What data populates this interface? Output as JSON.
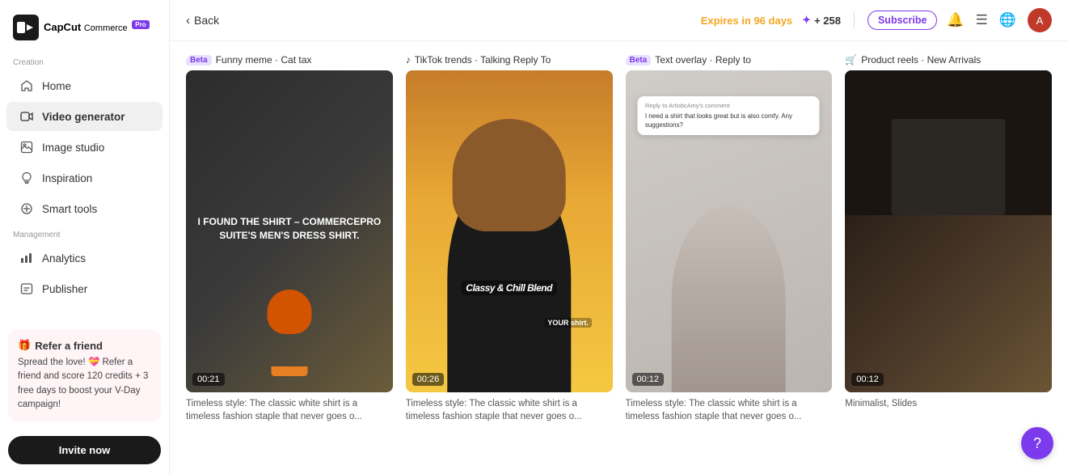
{
  "app": {
    "logo_text": "CapCut",
    "logo_sub": "Commerce",
    "logo_badge": "Pro"
  },
  "sidebar": {
    "section_creation": "Creation",
    "section_management": "Management",
    "items": [
      {
        "id": "home",
        "label": "Home",
        "icon": "home"
      },
      {
        "id": "video-generator",
        "label": "Video generator",
        "icon": "video",
        "active": true
      },
      {
        "id": "image-studio",
        "label": "Image studio",
        "icon": "image"
      },
      {
        "id": "inspiration",
        "label": "Inspiration",
        "icon": "inspiration"
      },
      {
        "id": "smart-tools",
        "label": "Smart tools",
        "icon": "smart"
      },
      {
        "id": "analytics",
        "label": "Analytics",
        "icon": "analytics"
      },
      {
        "id": "publisher",
        "label": "Publisher",
        "icon": "publisher"
      }
    ],
    "refer": {
      "title": "Refer a friend",
      "gift_icon": "🎁",
      "heart_icon": "💝",
      "description": "Spread the love! 💝 Refer a friend and score 120 credits + 3 free days to boost your V-Day campaign!"
    },
    "invite_label": "Invite now"
  },
  "header": {
    "back_label": "Back",
    "expires_text": "Expires in 96 days",
    "credits_plus": "+ 258",
    "subscribe_label": "Subscribe"
  },
  "cards": [
    {
      "id": "card-1",
      "badge": "Beta",
      "badge_type": "beta",
      "label": "Funny meme · Cat tax",
      "duration": "00:21",
      "description": "Timeless style: The classic white shirt is a timeless fashion staple that never goes o..."
    },
    {
      "id": "card-2",
      "badge": "🎵",
      "badge_type": "tiktok",
      "label": "TikTok trends · Talking Reply To",
      "duration": "00:26",
      "description": "Timeless style: The classic white shirt is a timeless fashion staple that never goes o..."
    },
    {
      "id": "card-3",
      "badge": "Beta",
      "badge_type": "beta",
      "label": "Text overlay · Reply to",
      "duration": "00:12",
      "description": "Timeless style: The classic white shirt is a timeless fashion staple that never goes o..."
    },
    {
      "id": "card-4",
      "badge": "🛒",
      "badge_type": "product",
      "label": "Product reels · New Arrivals",
      "duration": "00:12",
      "description": "Minimalist, Slides"
    }
  ],
  "help_button": "?",
  "reply_bubble": {
    "header": "Reply to ArtisticAmy's comment",
    "body": "I need a shirt that looks great but is also comfy. Any suggestions?"
  },
  "thumb_text_1": "I FOUND THE SHIRT – COMMERCEPRO SUITE'S MEN'S DRESS SHIRT.",
  "thumb_text_2": "Classy & Chill Blend",
  "thumb_text_your": "YOUR shirt."
}
